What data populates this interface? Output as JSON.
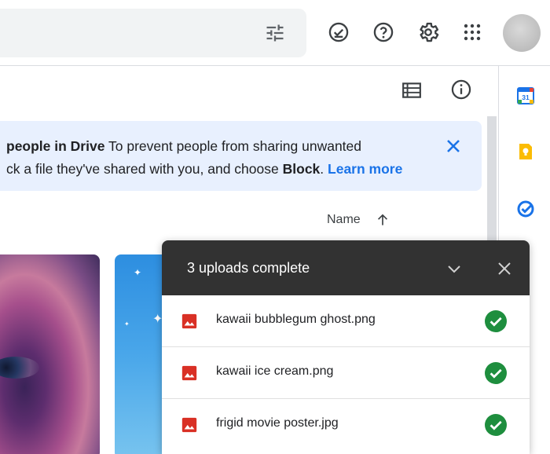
{
  "topbar": {
    "icons": [
      "search-options-icon",
      "offline-ready-icon",
      "help-icon",
      "settings-icon",
      "apps-grid-icon"
    ]
  },
  "toolbar": {
    "icons": [
      "list-view-icon",
      "info-icon"
    ]
  },
  "banner": {
    "title_fragment": "people in Drive",
    "text_line1": "To prevent people from sharing unwanted",
    "text_line2_start": "ck a file they've shared with you, and choose",
    "block_word": "Block",
    "period": ".",
    "link": "Learn more"
  },
  "sort": {
    "label": "Name"
  },
  "uploads": {
    "title": "3 uploads complete",
    "files": [
      {
        "name": "kawaii bubblegum ghost.png"
      },
      {
        "name": "kawaii ice cream.png"
      },
      {
        "name": "frigid movie poster.jpg"
      }
    ]
  },
  "side_panel": {
    "apps": [
      "calendar-icon",
      "keep-icon",
      "tasks-icon"
    ],
    "calendar_day": "31"
  },
  "colors": {
    "accent": "#1a73e8",
    "banner_bg": "#e8f0fe",
    "upload_header": "#323232",
    "success": "#1e8e3e",
    "file_icon": "#d93025"
  }
}
